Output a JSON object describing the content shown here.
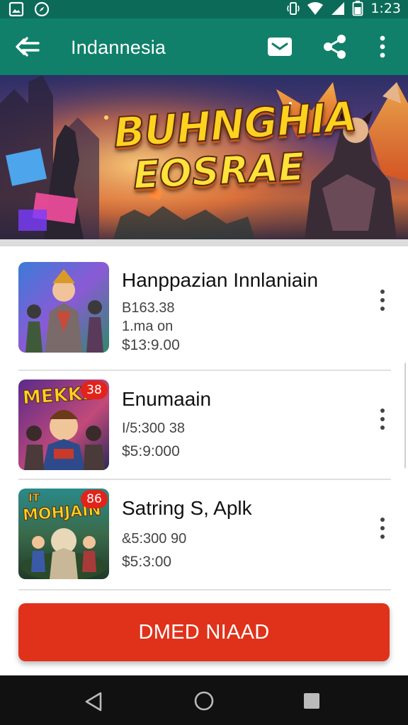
{
  "status_bar": {
    "time": "1:23"
  },
  "app_bar": {
    "title": "Indannesia"
  },
  "banner": {
    "title_line_1": "BUHNGHIA",
    "title_line_2": "EOSRAE"
  },
  "items": [
    {
      "title": "Hanppazian Innlaniain",
      "line_1": "B163.38",
      "line_2": "1.ma on",
      "price": "$13:9.00",
      "thumb_text": "",
      "badge": ""
    },
    {
      "title": "Enumaain",
      "line_1": "I/5:300 38",
      "line_2": "",
      "price": "$5:9:000",
      "thumb_text": "MEKKE",
      "badge": "38"
    },
    {
      "title": "Satring  S,  Aplk",
      "line_1": "&5:300 90",
      "line_2": "",
      "price": "$5:3:00",
      "thumb_text": "MOHJAIN",
      "thumb_text_small": "IT",
      "badge": "86"
    }
  ],
  "cta": {
    "label": "DMED NIAAD"
  },
  "colors": {
    "status_bar": "#0b6b58",
    "app_bar": "#10806a",
    "cta": "#e0321a",
    "nav_bar": "#111111"
  },
  "icons": {
    "status_left": [
      "gallery-icon",
      "compass-icon"
    ],
    "status_right": [
      "vibrate-icon",
      "wifi-icon",
      "signal-icon",
      "battery-icon"
    ],
    "app_bar": [
      "back-arrow-icon",
      "mail-icon",
      "share-icon",
      "more-vert-icon"
    ],
    "nav": [
      "nav-back-icon",
      "nav-home-icon",
      "nav-recent-icon"
    ]
  }
}
